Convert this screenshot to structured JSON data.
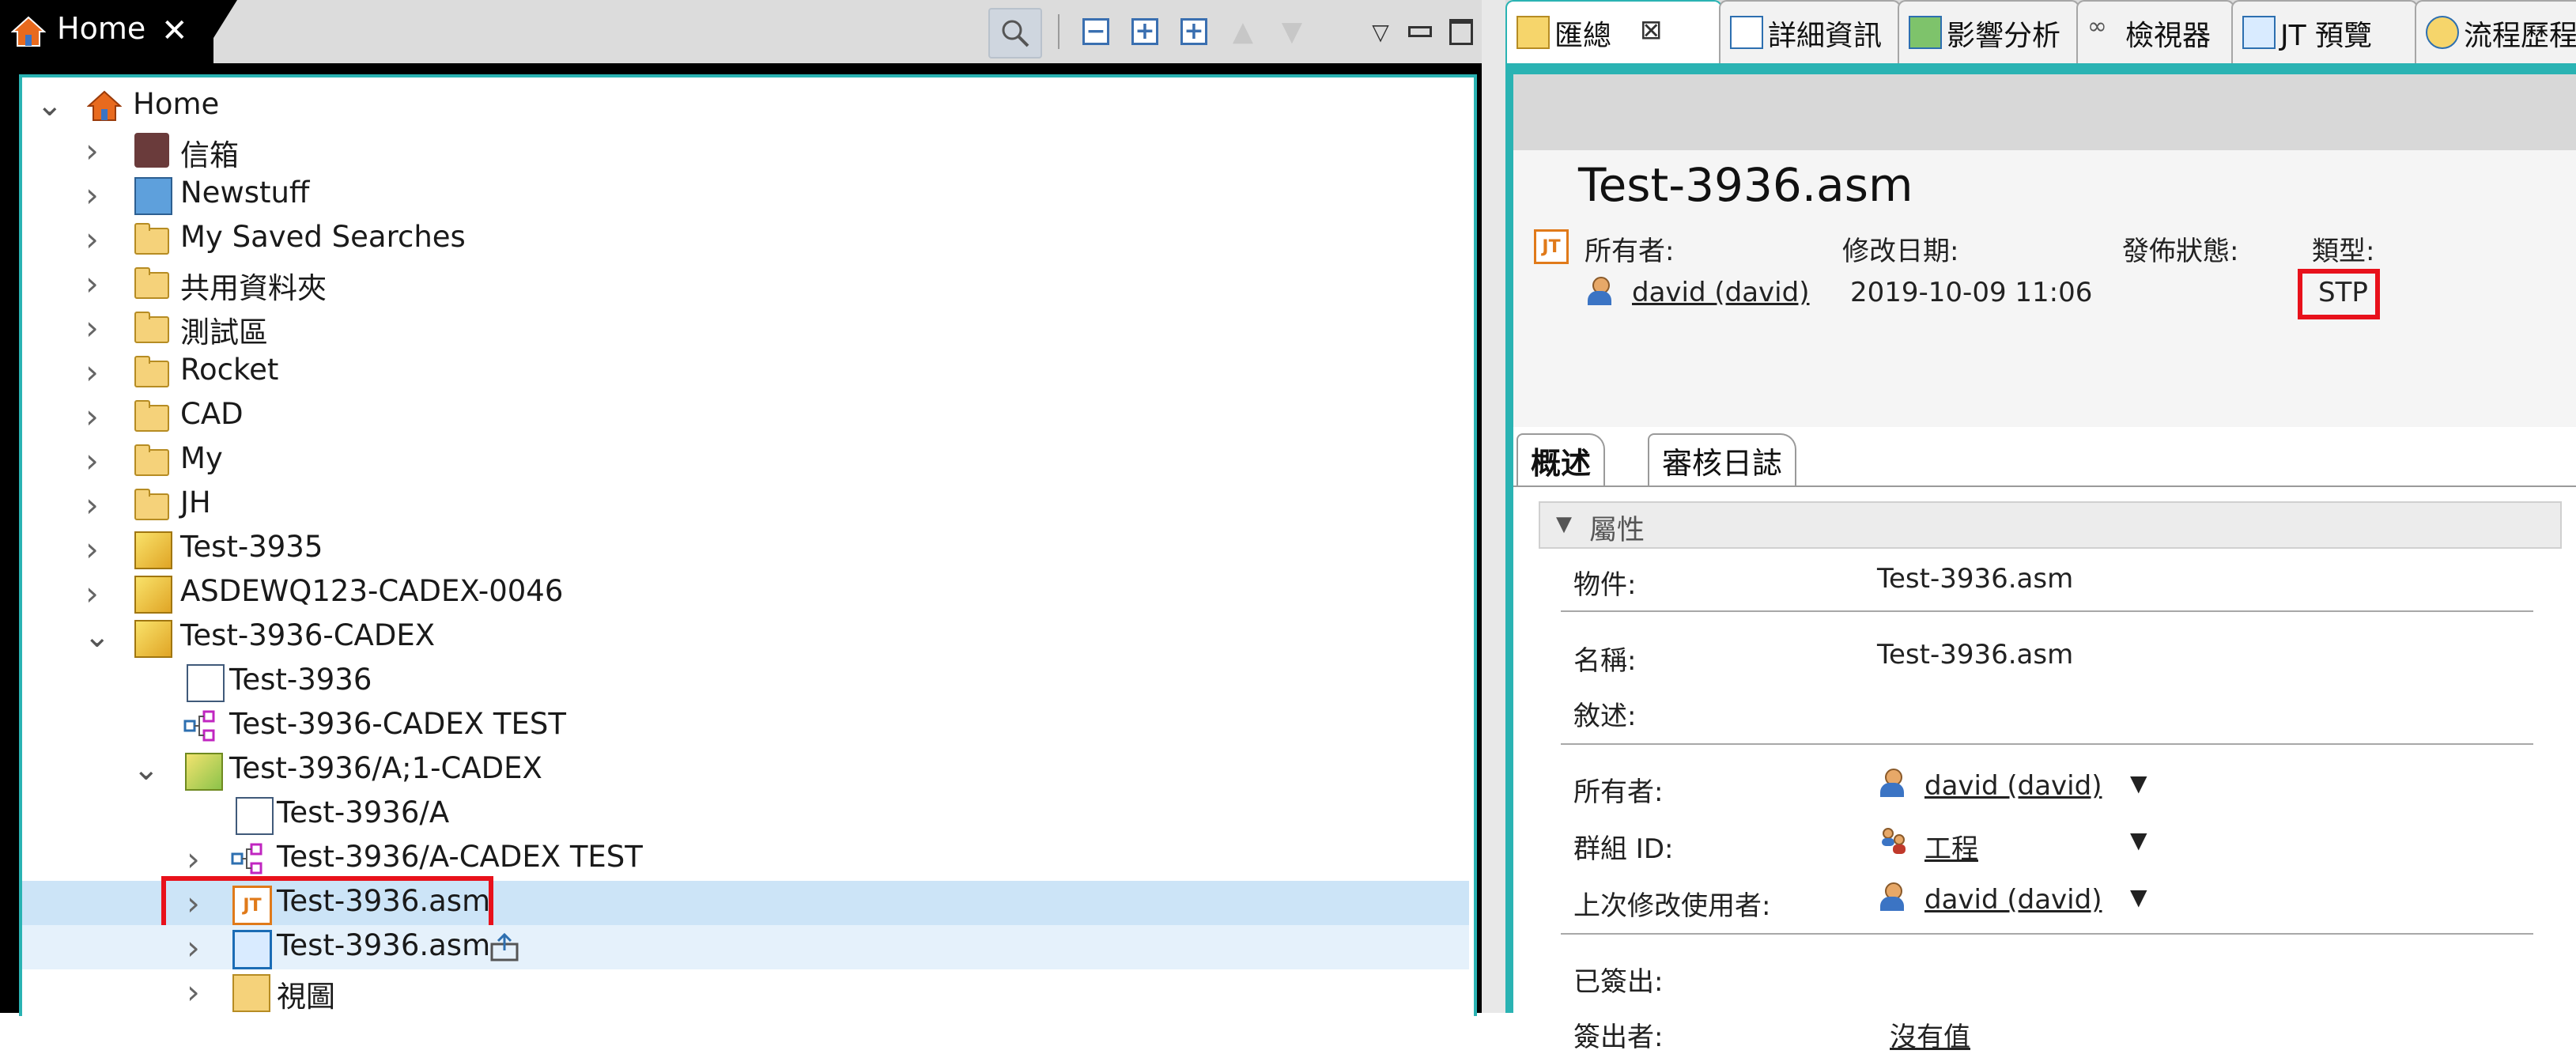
{
  "left_panel": {
    "tab_label": "Home",
    "toolbar_icons": [
      "search-icon",
      "collapse-all-icon",
      "expand-icon",
      "expand-all-icon",
      "up-arrow-icon",
      "down-arrow-icon",
      "view-menu-icon",
      "minimize-icon",
      "maximize-icon"
    ],
    "tree": [
      {
        "label": "Home",
        "expander": "expanded",
        "icon": "home-icon"
      },
      {
        "label": "信箱",
        "expander": "collapsed",
        "icon": "mailbox-icon"
      },
      {
        "label": "Newstuff",
        "expander": "collapsed",
        "icon": "newstuff-icon"
      },
      {
        "label": "My Saved Searches",
        "expander": "collapsed",
        "icon": "folder-icon"
      },
      {
        "label": "共用資料夾",
        "expander": "collapsed",
        "icon": "folder-icon"
      },
      {
        "label": "測試區",
        "expander": "collapsed",
        "icon": "folder-icon"
      },
      {
        "label": "Rocket",
        "expander": "collapsed",
        "icon": "folder-icon"
      },
      {
        "label": "CAD",
        "expander": "collapsed",
        "icon": "folder-icon"
      },
      {
        "label": "My",
        "expander": "collapsed",
        "icon": "folder-icon"
      },
      {
        "label": "JH",
        "expander": "collapsed",
        "icon": "folder-icon"
      },
      {
        "label": "Test-3935",
        "expander": "collapsed",
        "icon": "item-icon"
      },
      {
        "label": "ASDEWQ123-CADEX-0046",
        "expander": "collapsed",
        "icon": "item-icon"
      },
      {
        "label": "Test-3936-CADEX",
        "expander": "expanded",
        "icon": "item-icon"
      },
      {
        "label": "Test-3936",
        "expander": "none",
        "icon": "form-icon"
      },
      {
        "label": "Test-3936-CADEX TEST",
        "expander": "none",
        "icon": "bom-icon"
      },
      {
        "label": "Test-3936/A;1-CADEX",
        "expander": "expanded",
        "icon": "item-revision-icon"
      },
      {
        "label": "Test-3936/A",
        "expander": "none",
        "icon": "form-icon"
      },
      {
        "label": "Test-3936/A-CADEX TEST",
        "expander": "collapsed",
        "icon": "bom-icon"
      },
      {
        "label": "Test-3936.asm",
        "expander": "collapsed",
        "icon": "jt-icon"
      },
      {
        "label": "Test-3936.asm",
        "expander": "collapsed",
        "icon": "dataset-icon"
      },
      {
        "label": "視圖",
        "expander": "collapsed",
        "icon": "view-folder-icon"
      }
    ]
  },
  "right_panel": {
    "tabs": [
      {
        "label": "匯總",
        "icon": "summary-icon"
      },
      {
        "label": "詳細資訊",
        "icon": "details-icon"
      },
      {
        "label": "影響分析",
        "icon": "impact-icon"
      },
      {
        "label": "檢視器",
        "icon": "viewer-icon"
      },
      {
        "label": "JT 預覽",
        "icon": "jt-preview-icon"
      },
      {
        "label": "流程歷程",
        "icon": "process-history-icon"
      }
    ],
    "header": {
      "title": "Test-3936.asm",
      "owner_label": "所有者:",
      "owner_value": "david (david)",
      "modified_label": "修改日期:",
      "modified_value": "2019-10-09 11:06",
      "release_label": "發佈狀態:",
      "release_value": "",
      "type_label": "類型:",
      "type_value": "STP"
    },
    "subtabs": [
      "概述",
      "審核日誌"
    ],
    "section_title": "屬性",
    "properties": [
      {
        "label": "物件:",
        "value": "Test-3936.asm"
      },
      {
        "label": "名稱:",
        "value": "Test-3936.asm"
      },
      {
        "label": "敘述:",
        "value": ""
      },
      {
        "label": "所有者:",
        "value": "david (david)"
      },
      {
        "label": "群組 ID:",
        "value": "工程"
      },
      {
        "label": "上次修改使用者:",
        "value": "david (david)"
      },
      {
        "label": "已簽出:",
        "value": ""
      },
      {
        "label": "簽出者:",
        "value": "沒有值"
      }
    ]
  },
  "colors": {
    "accent": "#2ab3b3",
    "selection": "#cce4f7",
    "highlight_box": "#e8111b",
    "jt_orange": "#e07a1a"
  }
}
